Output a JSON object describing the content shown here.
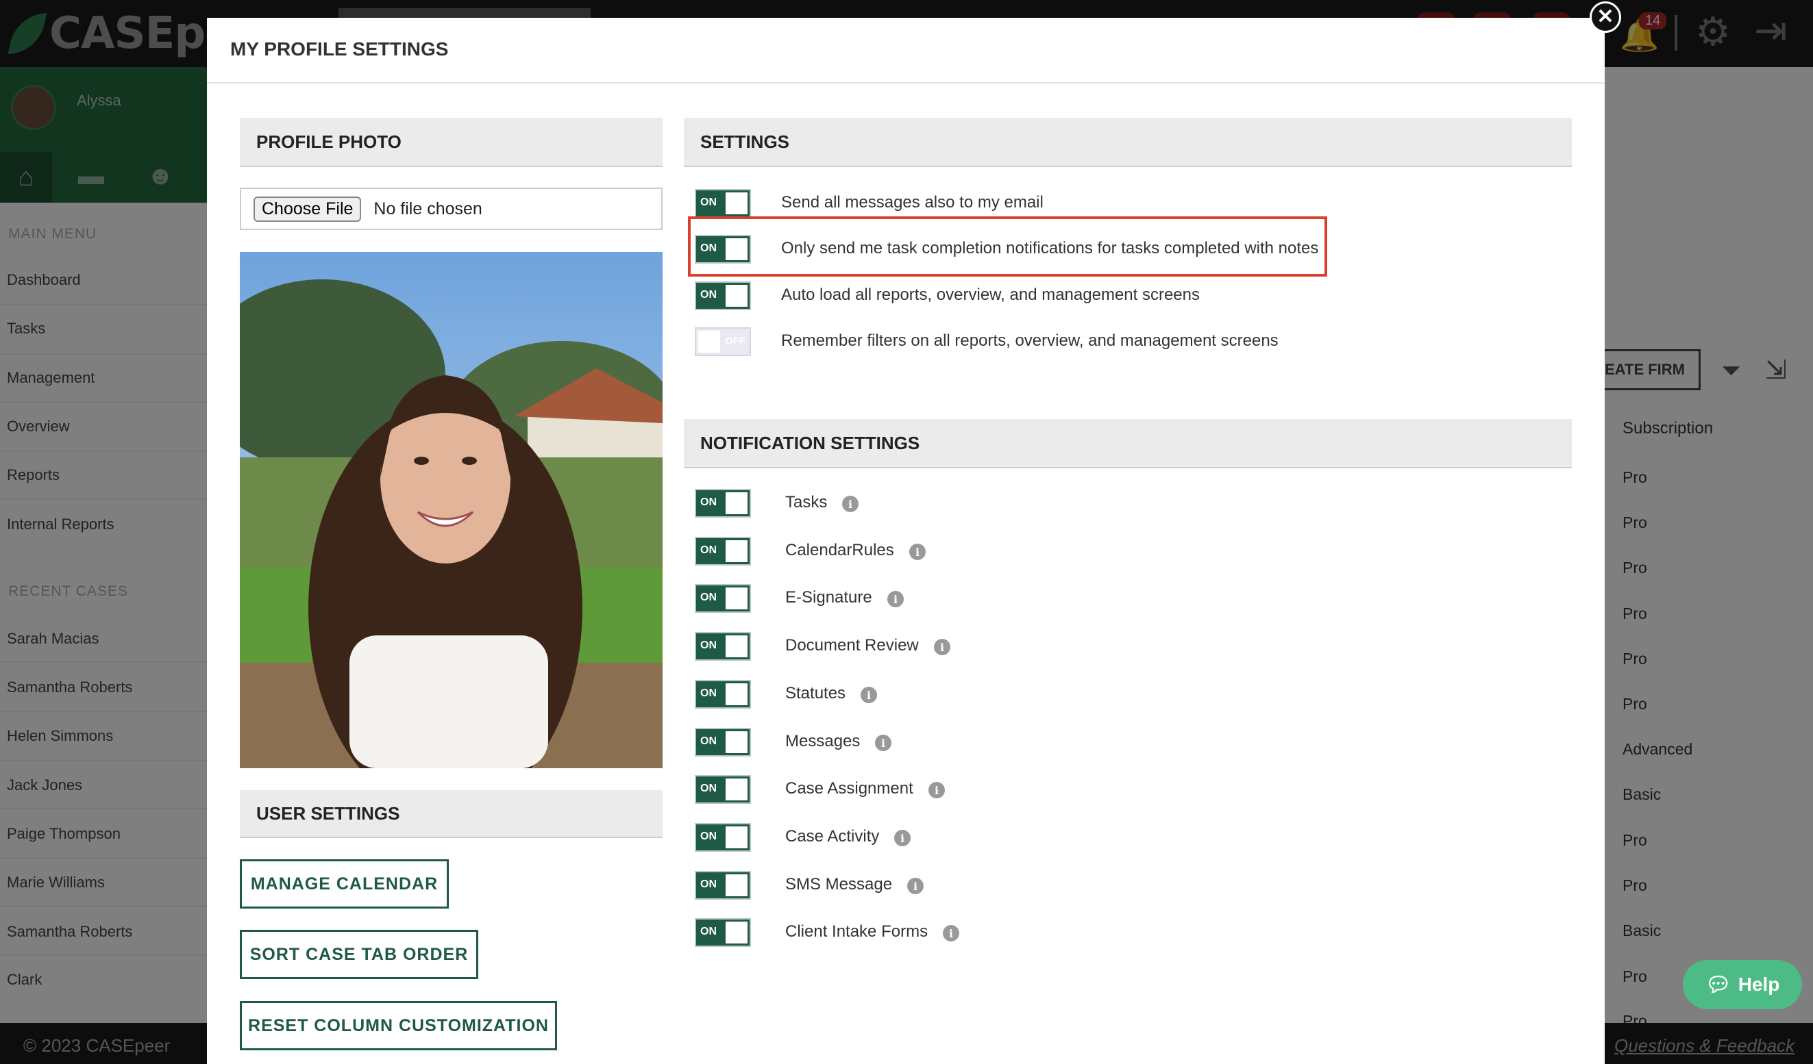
{
  "app": {
    "logo_text": "CASEpeer",
    "notification_count": "14"
  },
  "sidebar": {
    "user_name": "Alyssa",
    "main_menu_heading": "MAIN MENU",
    "main_menu": [
      "Dashboard",
      "Tasks",
      "Management",
      "Overview",
      "Reports",
      "Internal Reports"
    ],
    "recent_heading": "RECENT CASES",
    "recent_cases": [
      "Sarah Macias",
      "Samantha Roberts",
      "Helen Simmons",
      "Jack Jones",
      "Paige Thompson",
      "Marie Williams",
      "Samantha Roberts",
      "Clark"
    ]
  },
  "main": {
    "create_firm_label": "EATE FIRM",
    "subscription_header": "Subscription",
    "subscriptions": [
      "Pro",
      "Pro",
      "Pro",
      "Pro",
      "Pro",
      "Pro",
      "Advanced",
      "Basic",
      "Pro",
      "Pro",
      "Basic",
      "Pro",
      "Pro"
    ]
  },
  "footer": {
    "copyright": "© 2023 CASEpeer",
    "feedback_link": "Questions & Feedback"
  },
  "help": {
    "label": "Help"
  },
  "modal": {
    "title": "MY PROFILE SETTINGS",
    "close_symbol": "✕",
    "profile_photo_heading": "PROFILE PHOTO",
    "choose_file_label": "Choose File",
    "no_file_text": "No file chosen",
    "user_settings_heading": "USER SETTINGS",
    "buttons": {
      "manage_calendar": "MANAGE CALENDAR",
      "sort_case_tab_order": "SORT CASE TAB ORDER",
      "reset_column_customization": "RESET COLUMN CUSTOMIZATION"
    },
    "settings_heading": "SETTINGS",
    "toggle_on": "ON",
    "toggle_off": "OFF",
    "settings": [
      {
        "label": "Send all messages also to my email",
        "state": "on"
      },
      {
        "label": "Only send me task completion notifications for tasks completed with notes",
        "state": "on"
      },
      {
        "label": "Auto load all reports, overview, and management screens",
        "state": "on"
      },
      {
        "label": "Remember filters on all reports, overview, and management screens",
        "state": "off"
      }
    ],
    "notification_heading": "NOTIFICATION SETTINGS",
    "notifications": [
      {
        "label": "Tasks",
        "state": "on"
      },
      {
        "label": "CalendarRules",
        "state": "on"
      },
      {
        "label": "E-Signature",
        "state": "on"
      },
      {
        "label": "Document Review",
        "state": "on"
      },
      {
        "label": "Statutes",
        "state": "on"
      },
      {
        "label": "Messages",
        "state": "on"
      },
      {
        "label": "Case Assignment",
        "state": "on"
      },
      {
        "label": "Case Activity",
        "state": "on"
      },
      {
        "label": "SMS Message",
        "state": "on"
      },
      {
        "label": "Client Intake Forms",
        "state": "on"
      }
    ],
    "info_symbol": "i"
  },
  "colors": {
    "brand_green": "#256b3f",
    "toggle_on": "#1f5a46",
    "highlight": "#d9412c",
    "help": "#4dbb85"
  }
}
